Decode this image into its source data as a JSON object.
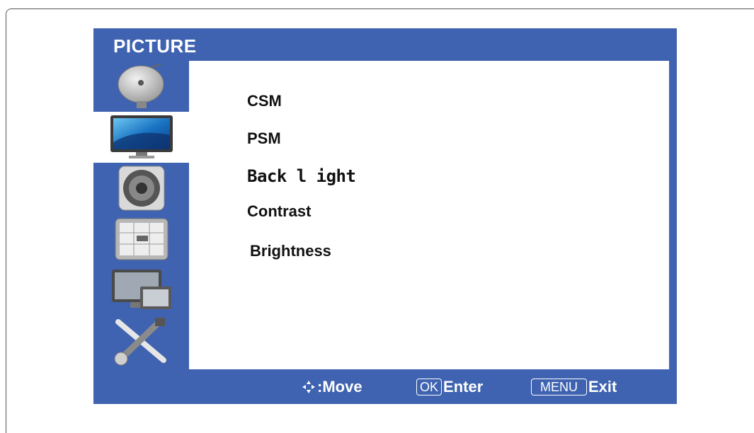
{
  "osd": {
    "title": "PICTURE",
    "sidebar": [
      {
        "name": "satellite-dish-icon",
        "active": false
      },
      {
        "name": "monitor-icon",
        "active": true
      },
      {
        "name": "speaker-icon",
        "active": false
      },
      {
        "name": "timer-grid-icon",
        "active": false
      },
      {
        "name": "pc-display-icon",
        "active": false
      },
      {
        "name": "tools-icon",
        "active": false
      }
    ],
    "menu_items": [
      "CSM",
      "PSM",
      "Back l ight",
      "Contrast",
      "Brightness"
    ],
    "footer": {
      "move_label": ":Move",
      "ok_key": "OK",
      "enter_label": "Enter",
      "menu_key": "MENU",
      "exit_label": "Exit"
    }
  },
  "colors": {
    "osd_blue": "#3f63b0",
    "panel_white": "#ffffff"
  }
}
